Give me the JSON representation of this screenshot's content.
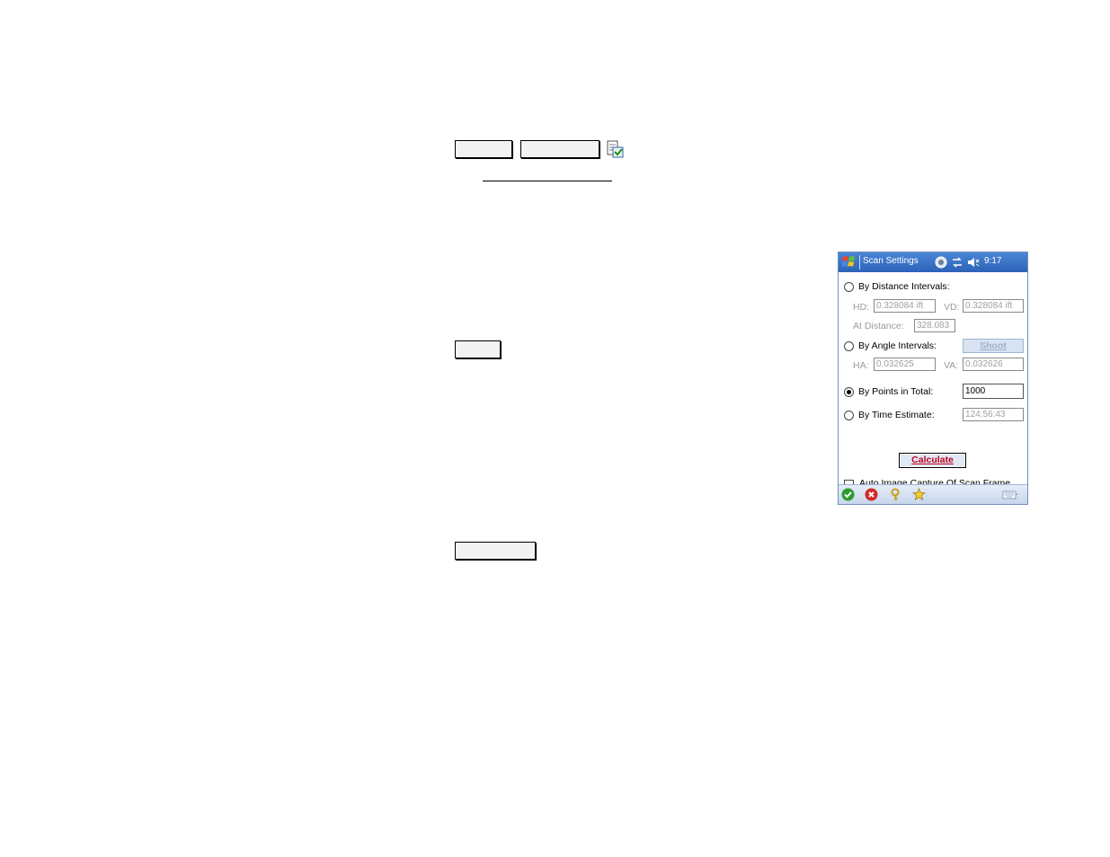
{
  "screen": {
    "title": "Scan Settings",
    "clock": "9:17",
    "options": {
      "distance_label": "By Distance Intervals:",
      "hd_label": "HD:",
      "hd_value": "0.328084 ift",
      "vd_label": "VD:",
      "vd_value": "0.328084 ift",
      "at_distance_label": "At Distance:",
      "at_distance_value": "328.083",
      "shoot_label": "Shoot",
      "angle_label": "By Angle Intervals:",
      "ha_label": "HA:",
      "ha_value": "0.032625",
      "va_label": "VA:",
      "va_value": "0.032626",
      "points_label": "By Points in Total:",
      "points_value": "1000",
      "time_label": "By Time Estimate:",
      "time_value": "124:56:43",
      "calculate_label": "Calculate",
      "auto_capture_label": "Auto Image Capture Of Scan Frame"
    },
    "selected_option": "points",
    "auto_capture_checked": false
  },
  "icons": {
    "start": "windows-flag-icon",
    "ok": "ok-check-icon",
    "cancel": "cancel-x-icon",
    "help": "help-key-icon",
    "favorite": "star-icon",
    "keyboard": "keyboard-icon"
  },
  "colors": {
    "titlebar": "#2c62b8",
    "calculate_text": "#c0001b",
    "ok_green": "#2e9b2e",
    "cancel_red": "#d22a2a"
  }
}
